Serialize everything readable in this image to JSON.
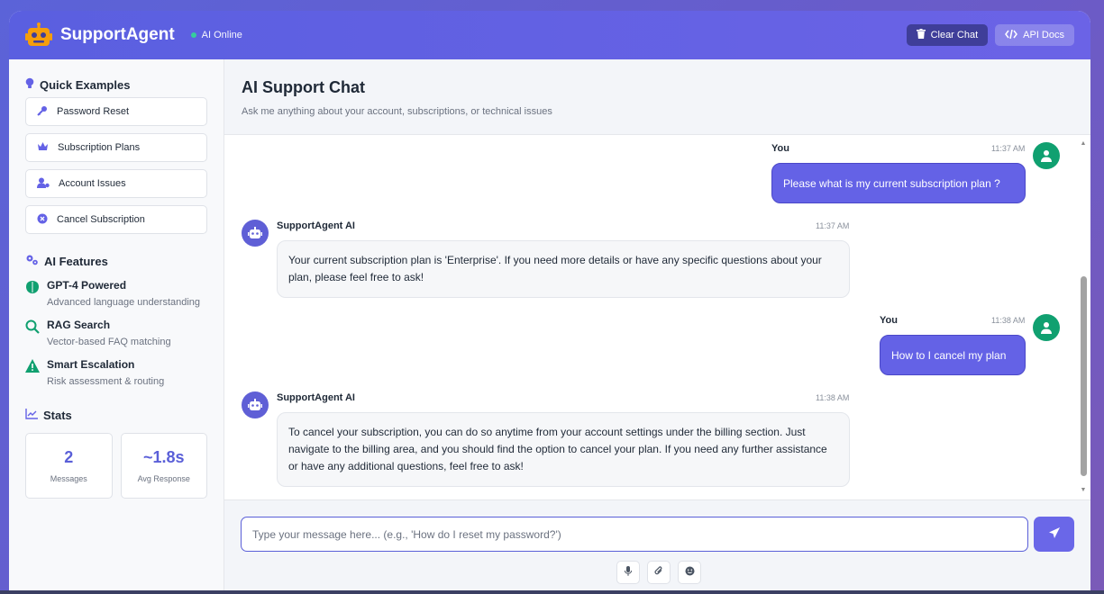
{
  "header": {
    "brand": "SupportAgent",
    "status": "AI Online",
    "clear_chat": "Clear Chat",
    "api_docs": "API Docs"
  },
  "sidebar": {
    "quick_title": "Quick Examples",
    "examples": [
      {
        "label": "Password Reset",
        "icon": "key-icon"
      },
      {
        "label": "Subscription Plans",
        "icon": "crown-icon"
      },
      {
        "label": "Account Issues",
        "icon": "user-cog-icon"
      },
      {
        "label": "Cancel Subscription",
        "icon": "cancel-circle-icon"
      }
    ],
    "features_title": "AI Features",
    "features": [
      {
        "name": "GPT-4 Powered",
        "desc": "Advanced language understanding",
        "icon": "brain-icon"
      },
      {
        "name": "RAG Search",
        "desc": "Vector-based FAQ matching",
        "icon": "search-icon"
      },
      {
        "name": "Smart Escalation",
        "desc": "Risk assessment & routing",
        "icon": "warning-icon"
      }
    ],
    "stats_title": "Stats",
    "stats": [
      {
        "value": "2",
        "label": "Messages"
      },
      {
        "value": "~1.8s",
        "label": "Avg Response"
      }
    ]
  },
  "chat": {
    "title": "AI Support Chat",
    "subtitle": "Ask me anything about your account, subscriptions, or technical issues",
    "messages": [
      {
        "sender": "You",
        "time": "11:37 AM",
        "text": "Please what is my current subscription plan ?"
      },
      {
        "sender": "SupportAgent AI",
        "time": "11:37 AM",
        "text": "Your current subscription plan is 'Enterprise'. If you need more details or have any specific questions about your plan, please feel free to ask!"
      },
      {
        "sender": "You",
        "time": "11:38 AM",
        "text": "How to I cancel my plan"
      },
      {
        "sender": "SupportAgent AI",
        "time": "11:38 AM",
        "text": "To cancel your subscription, you can do so anytime from your account settings under the billing section. Just navigate to the billing area, and you should find the option to cancel your plan. If you need any further assistance or have any additional questions, feel free to ask!"
      }
    ]
  },
  "composer": {
    "placeholder": "Type your message here... (e.g., 'How do I reset my password?')",
    "value": ""
  },
  "colors": {
    "accent": "#6462e6",
    "user_avatar": "#10a070",
    "online": "#34d399",
    "warning": "#10a070"
  }
}
